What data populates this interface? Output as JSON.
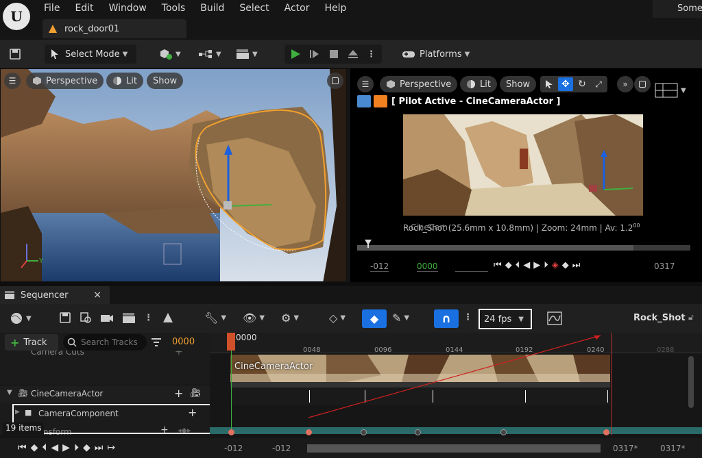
{
  "menu": {
    "items": [
      "File",
      "Edit",
      "Window",
      "Tools",
      "Build",
      "Select",
      "Actor",
      "Help"
    ],
    "user_label": "Some"
  },
  "document_tab": {
    "label": "rock_door01"
  },
  "toolbar": {
    "select_mode_label": "Select Mode",
    "platforms_label": "Platforms"
  },
  "viewport_left": {
    "perspective_label": "Perspective",
    "lit_label": "Lit",
    "show_label": "Show",
    "axis_x": "X",
    "axis_y": "Y"
  },
  "viewport_right": {
    "perspective_label": "Perspective",
    "lit_label": "Lit",
    "show_label": "Show",
    "pilot_label": "[ Pilot Active - CineCameraActor ]",
    "info_text": "Rock_Shot (25.6mm x 10.8mm) | Zoom: 24mm | Av: 1.2",
    "info_overlap": "CineCam",
    "info_superscript": "00",
    "start_time": "-012",
    "current_time": "0000",
    "end_time": "0317"
  },
  "sequencer": {
    "tab_label": "Sequencer",
    "close_icon_text": "×",
    "fps_label": "24 fps",
    "sequence_name": "Rock_Shot",
    "track_button_label": "Track",
    "search_placeholder": "Search Tracks",
    "current_frame": "0000",
    "playhead_label": "0000",
    "tick_labels": [
      "0048",
      "0096",
      "0144",
      "0192",
      "0240",
      "0288"
    ],
    "tracks": {
      "camera_cuts": "Camera Cuts",
      "cine_camera_actor": "CineCameraActor",
      "camera_component": "CameraComponent",
      "transform": "Transform",
      "thumbnail_label": "CineCameraActor"
    },
    "item_count": "19 items",
    "bottom": {
      "start_in": "-012",
      "start_out": "-012",
      "end_in": "0317*",
      "end_out": "0317*"
    }
  },
  "colors": {
    "accent_blue": "#1a70e0",
    "play_green": "#3fb03f",
    "selection_orange": "#f0a030",
    "track_teal": "#2a6a68",
    "key_red": "#e05050",
    "frame_orange": "#ff9900"
  }
}
